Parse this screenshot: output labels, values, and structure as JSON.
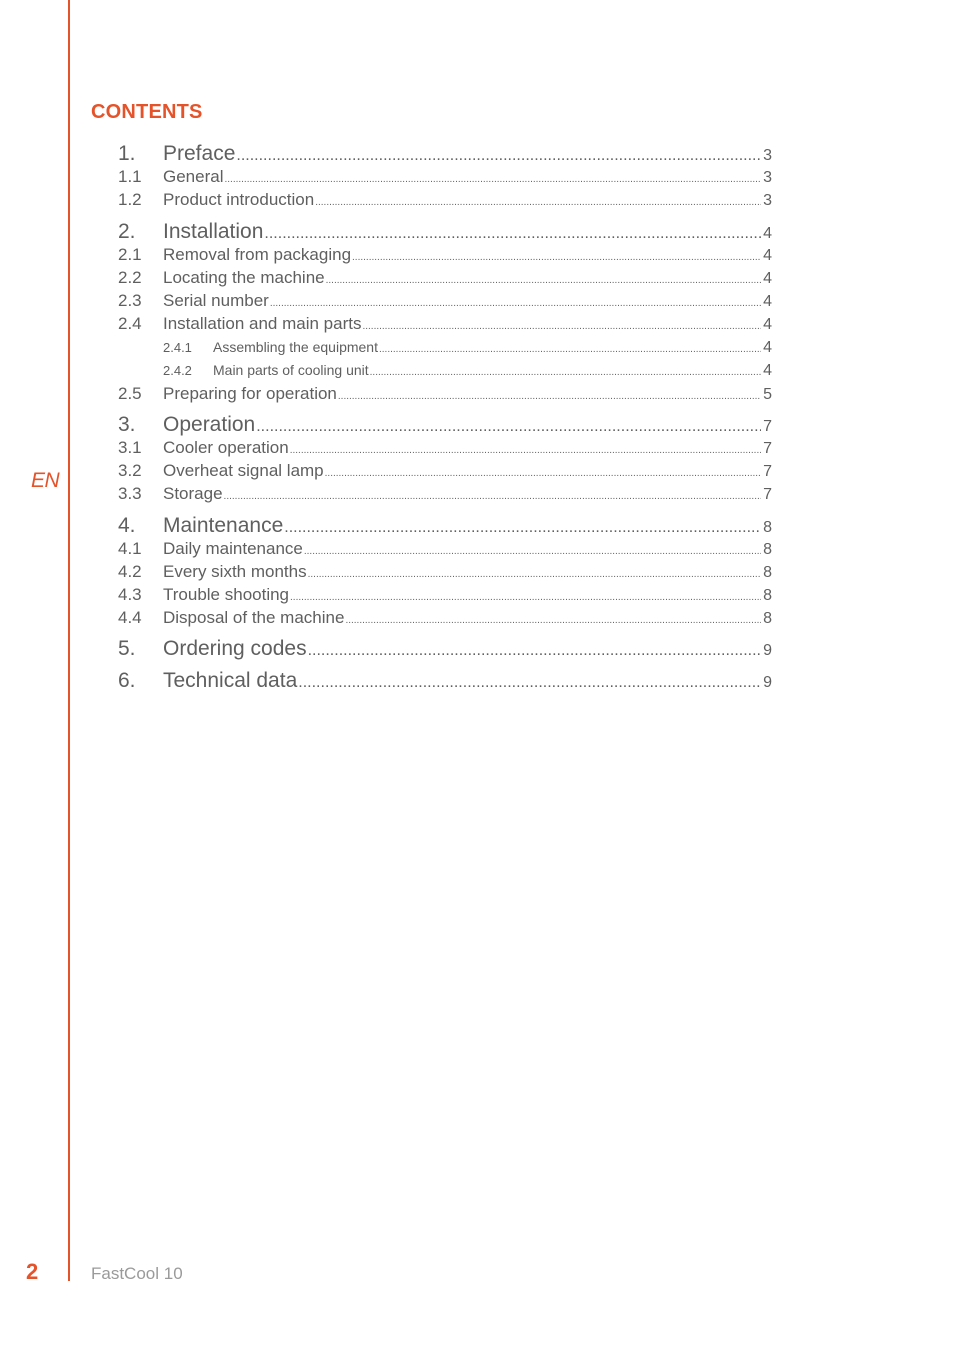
{
  "language": "EN",
  "title": "CONTENTS",
  "colors": {
    "accent": "#e5532a",
    "text": "#5f5f5f",
    "footer_text": "#9a9a9a"
  },
  "toc": [
    {
      "level": 1,
      "number": "1.",
      "label": "Preface",
      "page": "3"
    },
    {
      "level": 2,
      "number": "1.1",
      "label": "General",
      "page": "3"
    },
    {
      "level": 2,
      "number": "1.2",
      "label": "Product introduction",
      "page": "3"
    },
    {
      "level": 1,
      "number": "2.",
      "label": "Installation",
      "page": "4"
    },
    {
      "level": 2,
      "number": "2.1",
      "label": "Removal from packaging",
      "page": "4"
    },
    {
      "level": 2,
      "number": "2.2",
      "label": "Locating the machine",
      "page": "4"
    },
    {
      "level": 2,
      "number": "2.3",
      "label": "Serial number",
      "page": "4"
    },
    {
      "level": 2,
      "number": "2.4",
      "label": "Installation and main parts",
      "page": "4"
    },
    {
      "level": 3,
      "number": "2.4.1",
      "label": "Assembling the equipment",
      "page": "4"
    },
    {
      "level": 3,
      "number": "2.4.2",
      "label": "Main parts of cooling unit",
      "page": "4"
    },
    {
      "level": 2,
      "number": "2.5",
      "label": "Preparing for operation",
      "page": "5"
    },
    {
      "level": 1,
      "number": "3.",
      "label": "Operation",
      "page": "7"
    },
    {
      "level": 2,
      "number": "3.1",
      "label": "Cooler operation",
      "page": "7"
    },
    {
      "level": 2,
      "number": "3.2",
      "label": "Overheat signal lamp",
      "page": "7"
    },
    {
      "level": 2,
      "number": "3.3",
      "label": "Storage",
      "page": "7"
    },
    {
      "level": 1,
      "number": "4.",
      "label": "Maintenance",
      "page": "8"
    },
    {
      "level": 2,
      "number": "4.1",
      "label": "Daily maintenance",
      "page": "8"
    },
    {
      "level": 2,
      "number": "4.2",
      "label": "Every sixth months",
      "page": "8"
    },
    {
      "level": 2,
      "number": "4.3",
      "label": "Trouble shooting",
      "page": "8"
    },
    {
      "level": 2,
      "number": "4.4",
      "label": "Disposal of the machine",
      "page": "8"
    },
    {
      "level": 1,
      "number": "5.",
      "label": "Ordering codes",
      "page": "9"
    },
    {
      "level": 1,
      "number": "6.",
      "label": "Technical data",
      "page": "9"
    }
  ],
  "footer": {
    "page_number": "2",
    "product": "FastCool 10"
  }
}
